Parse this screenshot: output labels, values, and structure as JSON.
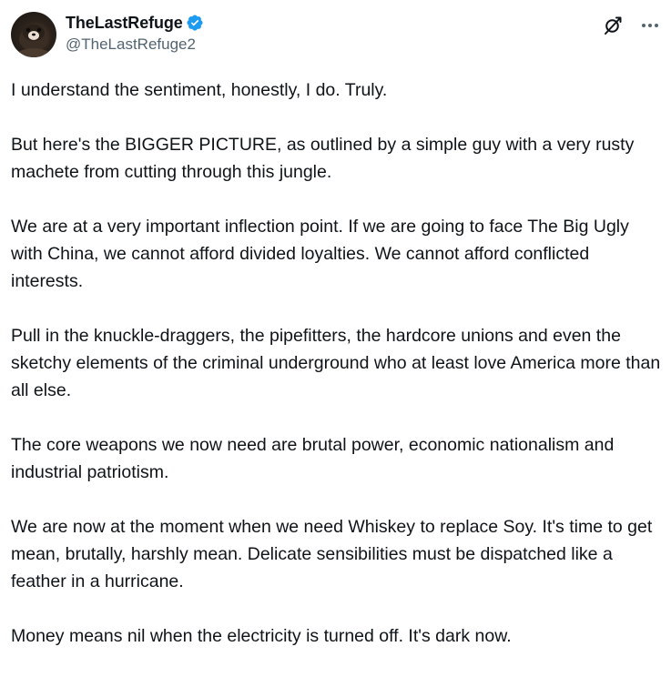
{
  "author": {
    "display_name": "TheLastRefuge",
    "handle": "@TheLastRefuge2",
    "verified": true,
    "avatar_icon": "avatar-image"
  },
  "actions": {
    "grok_icon": "grok-icon",
    "more_icon": "more-options-icon"
  },
  "colors": {
    "text": "#0f1419",
    "secondary_text": "#536471",
    "verified_blue": "#1d9bf0",
    "background": "#ffffff"
  },
  "tweet": {
    "paragraphs": [
      "I understand the sentiment, honestly, I do. Truly.",
      "But here's the BIGGER PICTURE, as outlined by a simple guy with a very rusty machete from cutting through this jungle.",
      "We are at a very important inflection point.  If we are going to face The Big Ugly with China, we cannot afford divided loyalties. We cannot afford conflicted interests.",
      "Pull in the knuckle-draggers, the pipefitters, the hardcore unions and even the sketchy elements of the criminal underground who at least love America more than all else.",
      "The core weapons we now need are brutal power, economic nationalism and industrial patriotism.",
      "We are now at the moment when we need Whiskey to replace Soy.  It's time to get mean, brutally, harshly mean.  Delicate sensibilities must be dispatched like a feather in a hurricane.",
      "Money means nil when the electricity is turned off.  It's dark now."
    ]
  }
}
